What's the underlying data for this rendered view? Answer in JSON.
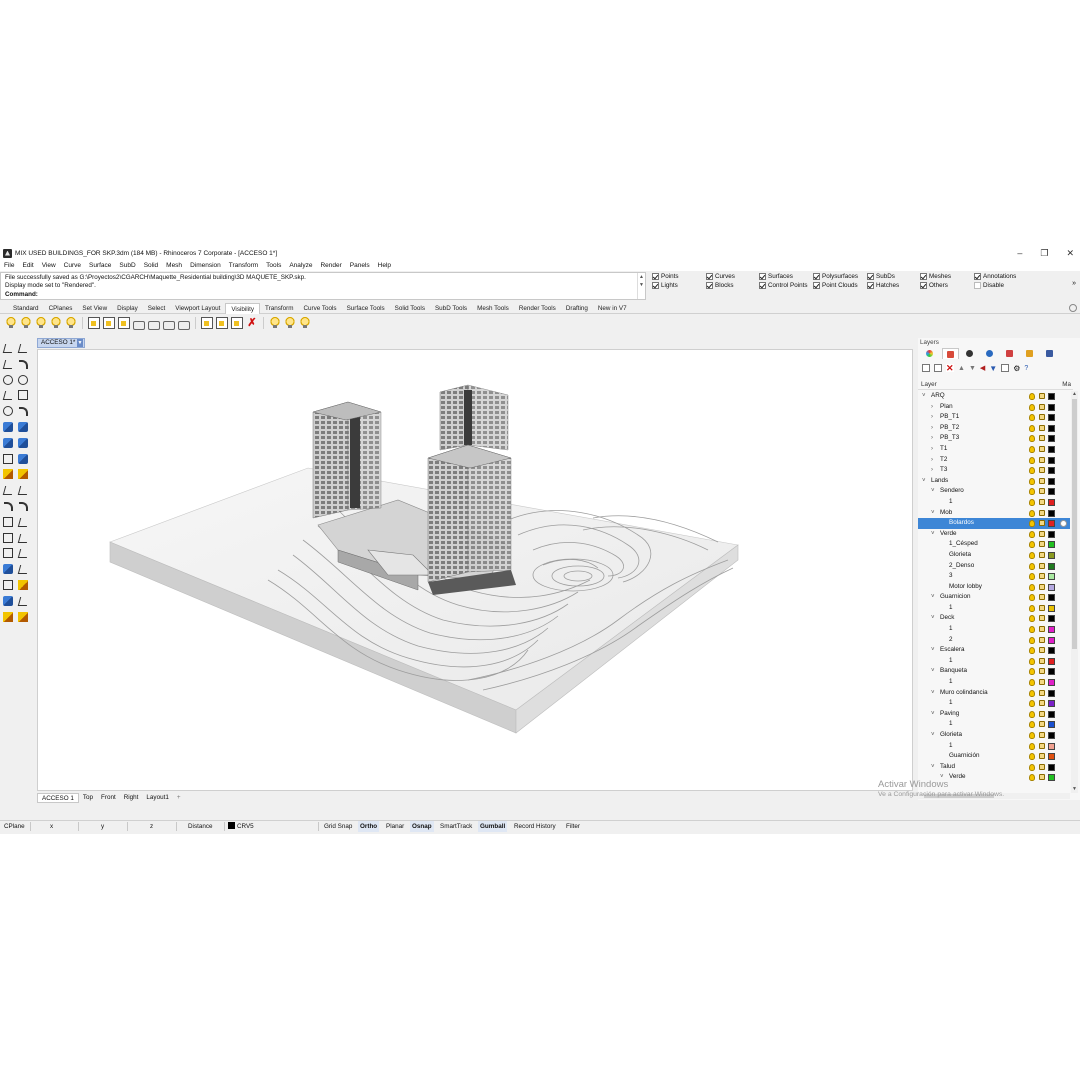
{
  "window": {
    "title": "MIX USED BUILDINGS_FOR SKP.3dm (184 MB) - Rhinoceros 7 Corporate - [ACCESO 1*]",
    "minimize": "–",
    "maximize": "❐",
    "close": "✕"
  },
  "menu": [
    "File",
    "Edit",
    "View",
    "Curve",
    "Surface",
    "SubD",
    "Solid",
    "Mesh",
    "Dimension",
    "Transform",
    "Tools",
    "Analyze",
    "Render",
    "Panels",
    "Help"
  ],
  "command_history": {
    "line1": "File successfully saved as G:\\Proyectos2\\CGARCH\\Maquette_Residential building\\3D MAQUETE_SKP.skp.",
    "line2": "Display mode set to \"Rendered\".",
    "prompt": "Command:",
    "value": ""
  },
  "selection_filters": [
    {
      "label": "Points",
      "checked": true
    },
    {
      "label": "Curves",
      "checked": true
    },
    {
      "label": "Surfaces",
      "checked": true
    },
    {
      "label": "Polysurfaces",
      "checked": true
    },
    {
      "label": "SubDs",
      "checked": true
    },
    {
      "label": "Meshes",
      "checked": true
    },
    {
      "label": "Annotations",
      "checked": true
    },
    {
      "label": "Lights",
      "checked": true
    },
    {
      "label": "Blocks",
      "checked": true
    },
    {
      "label": "Control Points",
      "checked": true
    },
    {
      "label": "Point Clouds",
      "checked": true
    },
    {
      "label": "Hatches",
      "checked": true
    },
    {
      "label": "Others",
      "checked": true
    },
    {
      "label": "Disable",
      "checked": false
    }
  ],
  "toolbar_tabs": [
    "Standard",
    "CPlanes",
    "Set View",
    "Display",
    "Select",
    "Viewport Layout",
    "Visibility",
    "Transform",
    "Curve Tools",
    "Surface Tools",
    "Solid Tools",
    "SubD Tools",
    "Mesh Tools",
    "Render Tools",
    "Drafting",
    "New in V7"
  ],
  "active_toolbar_tab": "Visibility",
  "viewport": {
    "active_tab": "ACCESO 1*",
    "display_mode": "Rendered",
    "bottom_tabs": [
      "ACCESO 1",
      "Top",
      "Front",
      "Right",
      "Layout1"
    ],
    "add_tab": "+"
  },
  "status_bar": {
    "cplane": "CPlane",
    "x": "x",
    "y": "y",
    "z": "z",
    "distance": "Distance",
    "layer": "CRV5",
    "layer_color": "#000000",
    "toggles": [
      {
        "label": "Grid Snap",
        "on": false
      },
      {
        "label": "Ortho",
        "on": true
      },
      {
        "label": "Planar",
        "on": false
      },
      {
        "label": "Osnap",
        "on": true
      },
      {
        "label": "SmartTrack",
        "on": false
      },
      {
        "label": "Gumball",
        "on": true
      },
      {
        "label": "Record History",
        "on": false
      },
      {
        "label": "Filter",
        "on": false
      }
    ]
  },
  "layers_panel": {
    "title": "Layers",
    "col_layer": "Layer",
    "col_material": "Ma",
    "rows": [
      {
        "name": "ARQ",
        "level": 0,
        "twisty": "˅",
        "color": "#000000"
      },
      {
        "name": "Plan",
        "level": 1,
        "twisty": "›",
        "color": "#000000"
      },
      {
        "name": "PB_T1",
        "level": 1,
        "twisty": "›",
        "color": "#000000"
      },
      {
        "name": "PB_T2",
        "level": 1,
        "twisty": "›",
        "color": "#000000"
      },
      {
        "name": "PB_T3",
        "level": 1,
        "twisty": "›",
        "color": "#000000"
      },
      {
        "name": "T1",
        "level": 1,
        "twisty": "›",
        "color": "#000000"
      },
      {
        "name": "T2",
        "level": 1,
        "twisty": "›",
        "color": "#000000"
      },
      {
        "name": "T3",
        "level": 1,
        "twisty": "›",
        "color": "#000000"
      },
      {
        "name": "Lands",
        "level": 0,
        "twisty": "˅",
        "color": "#000000"
      },
      {
        "name": "Sendero",
        "level": 1,
        "twisty": "˅",
        "color": "#000000"
      },
      {
        "name": "1",
        "level": 2,
        "twisty": "",
        "color": "#e02020"
      },
      {
        "name": "Mob",
        "level": 1,
        "twisty": "˅",
        "color": "#000000"
      },
      {
        "name": "Bolardos",
        "level": 2,
        "twisty": "",
        "color": "#e02020",
        "selected": true
      },
      {
        "name": "Verde",
        "level": 1,
        "twisty": "˅",
        "color": "#000000"
      },
      {
        "name": "1_Césped",
        "level": 2,
        "twisty": "",
        "color": "#22c022"
      },
      {
        "name": "Glorieta",
        "level": 2,
        "twisty": "",
        "color": "#8a9a20"
      },
      {
        "name": "2_Denso",
        "level": 2,
        "twisty": "",
        "color": "#1f7a1f"
      },
      {
        "name": "3",
        "level": 2,
        "twisty": "",
        "color": "#a8e8a0"
      },
      {
        "name": "Motor lobby",
        "level": 2,
        "twisty": "",
        "color": "#b4a8e0"
      },
      {
        "name": "Guarnicion",
        "level": 1,
        "twisty": "˅",
        "color": "#000000"
      },
      {
        "name": "1",
        "level": 2,
        "twisty": "",
        "color": "#e8c000"
      },
      {
        "name": "Deck",
        "level": 1,
        "twisty": "˅",
        "color": "#000000"
      },
      {
        "name": "1",
        "level": 2,
        "twisty": "",
        "color": "#e020c8"
      },
      {
        "name": "2",
        "level": 2,
        "twisty": "",
        "color": "#e020c8"
      },
      {
        "name": "Escalera",
        "level": 1,
        "twisty": "˅",
        "color": "#000000"
      },
      {
        "name": "1",
        "level": 2,
        "twisty": "",
        "color": "#e02020"
      },
      {
        "name": "Banqueta",
        "level": 1,
        "twisty": "˅",
        "color": "#000000"
      },
      {
        "name": "1",
        "level": 2,
        "twisty": "",
        "color": "#e020c8"
      },
      {
        "name": "Muro colindancia",
        "level": 1,
        "twisty": "˅",
        "color": "#000000"
      },
      {
        "name": "1",
        "level": 2,
        "twisty": "",
        "color": "#7a20c8"
      },
      {
        "name": "Paving",
        "level": 1,
        "twisty": "˅",
        "color": "#000000"
      },
      {
        "name": "1",
        "level": 2,
        "twisty": "",
        "color": "#1a50d0"
      },
      {
        "name": "Glorieta",
        "level": 1,
        "twisty": "˅",
        "color": "#000000"
      },
      {
        "name": "1",
        "level": 2,
        "twisty": "",
        "color": "#f0a090"
      },
      {
        "name": "Guarnición",
        "level": 2,
        "twisty": "",
        "color": "#e05010"
      },
      {
        "name": "Talud",
        "level": 1,
        "twisty": "˅",
        "color": "#000000"
      },
      {
        "name": "Verde",
        "level": 2,
        "twisty": "˅",
        "color": "#22c022"
      }
    ]
  },
  "watermark": {
    "line1": "Activar Windows",
    "line2": "Ve a Configuración para activar Windows."
  }
}
